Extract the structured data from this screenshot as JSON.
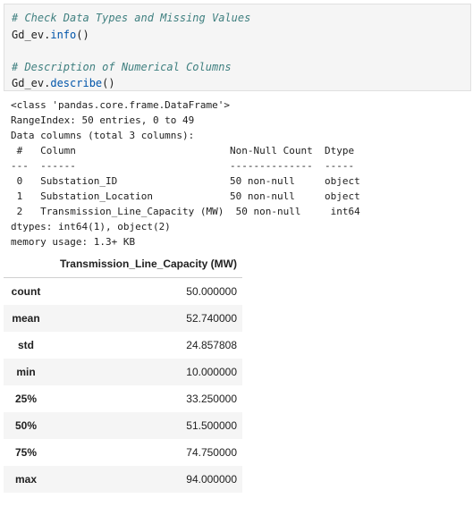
{
  "code": {
    "lines": [
      "# Check Data Types and Missing Values",
      "Gd_ev.",
      "info",
      "()",
      "# Description of Numerical Columns",
      "Gd_ev.",
      "describe",
      "()"
    ]
  },
  "info_output": {
    "lines": [
      "<class 'pandas.core.frame.DataFrame'>",
      "RangeIndex: 50 entries, 0 to 49",
      "Data columns (total 3 columns):",
      " #   Column                          Non-Null Count  Dtype",
      "---  ------                          --------------  -----",
      " 0   Substation_ID                   50 non-null     object",
      " 1   Substation_Location             50 non-null     object",
      " 2   Transmission_Line_Capacity (MW)  50 non-null     int64",
      "dtypes: int64(1), object(2)",
      "memory usage: 1.3+ KB"
    ]
  },
  "describe_table": {
    "column": "Transmission_Line_Capacity (MW)",
    "rows": [
      {
        "index": "count",
        "value": "50.000000"
      },
      {
        "index": "mean",
        "value": "52.740000"
      },
      {
        "index": "std",
        "value": "24.857808"
      },
      {
        "index": "min",
        "value": "10.000000"
      },
      {
        "index": "25%",
        "value": "33.250000"
      },
      {
        "index": "50%",
        "value": "51.500000"
      },
      {
        "index": "75%",
        "value": "74.750000"
      },
      {
        "index": "max",
        "value": "94.000000"
      }
    ]
  }
}
